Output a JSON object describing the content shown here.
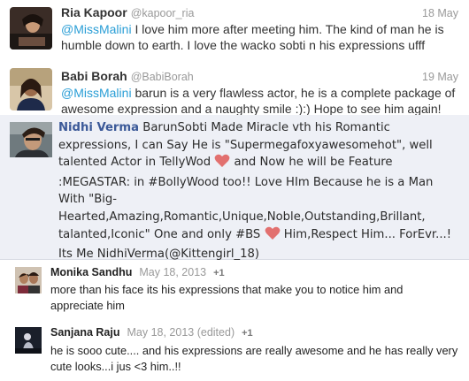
{
  "tweets": [
    {
      "name": "Ria Kapoor",
      "handle": "@kapoor_ria",
      "date": "18 May",
      "mention": "@MissMalini",
      "text": " I love him more after meeting him. The kind of man he is humble down to earth. I love the wacko sobti n his expressions ufff"
    },
    {
      "name": "Babi Borah",
      "handle": "@BabiBorah",
      "date": "19 May",
      "mention": "@MissMalini",
      "text": " barun is  a very flawless  actor, he is a complete package of awesome expression and a naughty smile :):) Hope to see him again!"
    }
  ],
  "fb_comment": {
    "author": "Nidhi Verma",
    "part1": " BarunSobti Made Miracle vth his Romantic expressions, I can Say He is \"Supermegafoxyawesomehot\", well talented Actor in TellyWod ",
    "part2": " and Now he will be Feature :MEGASTAR: in #BollyWood too!! Love HIm Because he is a Man With \"Big-Hearted,Amazing,Romantic,Unique,Noble,Outstanding,Brillant, talanted,Iconic\" One and only #BS ",
    "part3": " Him,Respect Him... ForEvr...! Its Me NidhiVerma(@Kittengirl_18)",
    "heart_color": "#e2706f"
  },
  "comments": [
    {
      "name": "Monika Sandhu",
      "date": "May 18, 2013",
      "plus": "+1",
      "text": "more than his face its his expressions that make you to notice him and appreciate him"
    },
    {
      "name": "Sanjana Raju",
      "date": "May 18, 2013 (edited)",
      "plus": "+1",
      "text": "he is sooo cute.... and his expressions are really awesome and he has really very cute looks...i jus <3 him..!!"
    }
  ]
}
